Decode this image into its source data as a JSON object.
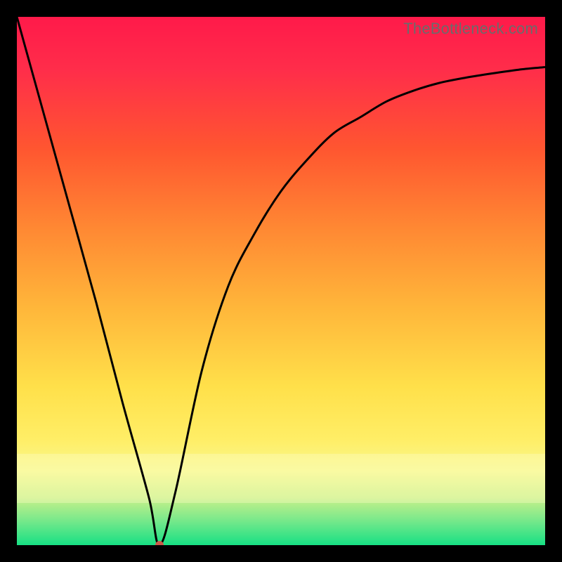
{
  "watermark": "TheBottleneck.com",
  "chart_data": {
    "type": "line",
    "title": "",
    "xlabel": "",
    "ylabel": "",
    "xlim": [
      0,
      100
    ],
    "ylim": [
      0,
      100
    ],
    "legend": false,
    "grid": false,
    "series": [
      {
        "name": "curve",
        "x": [
          0,
          5,
          10,
          15,
          20,
          25,
          27,
          30,
          35,
          40,
          45,
          50,
          55,
          60,
          65,
          70,
          75,
          80,
          85,
          90,
          95,
          100
        ],
        "y": [
          100,
          82,
          64,
          46,
          27,
          9,
          0,
          10,
          33,
          49,
          59,
          67,
          73,
          78,
          81,
          84,
          86,
          87.5,
          88.5,
          89.3,
          90,
          90.5
        ]
      }
    ],
    "marker": {
      "x": 27,
      "y": 0,
      "color": "#cc5a4a"
    },
    "background_gradient": {
      "top": "#ff1a4a",
      "mid": "#ffd84a",
      "bottom": "#17e084"
    }
  }
}
